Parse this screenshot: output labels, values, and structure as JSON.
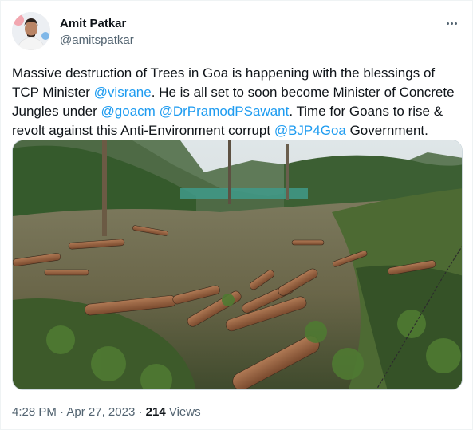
{
  "author": {
    "name": "Amit Patkar",
    "handle": "@amitspatkar"
  },
  "tweet": {
    "parts": [
      {
        "text": "Massive destruction of Trees in Goa is happening with the blessings of TCP Minister ",
        "type": "text"
      },
      {
        "text": "@visrane",
        "type": "mention"
      },
      {
        "text": ". He is all set to soon become Minister of Concrete Jungles under ",
        "type": "text"
      },
      {
        "text": "@goacm",
        "type": "mention"
      },
      {
        "text": " ",
        "type": "text"
      },
      {
        "text": "@DrPramodPSawant",
        "type": "mention"
      },
      {
        "text": ". Time for Goans to rise & revolt against this Anti-Environment corrupt ",
        "type": "text"
      },
      {
        "text": "@BJP4Goa",
        "type": "mention"
      },
      {
        "text": " Government.",
        "type": "text"
      }
    ]
  },
  "meta": {
    "time": "4:28 PM",
    "separator1": " · ",
    "date": "Apr 27, 2023",
    "separator2": " · ",
    "views_count": "214",
    "views_label": " Views"
  },
  "colors": {
    "link": "#1d9bf0",
    "text": "#0f1419",
    "secondary": "#536471"
  },
  "icons": {
    "more": "more-horizontal-icon"
  }
}
